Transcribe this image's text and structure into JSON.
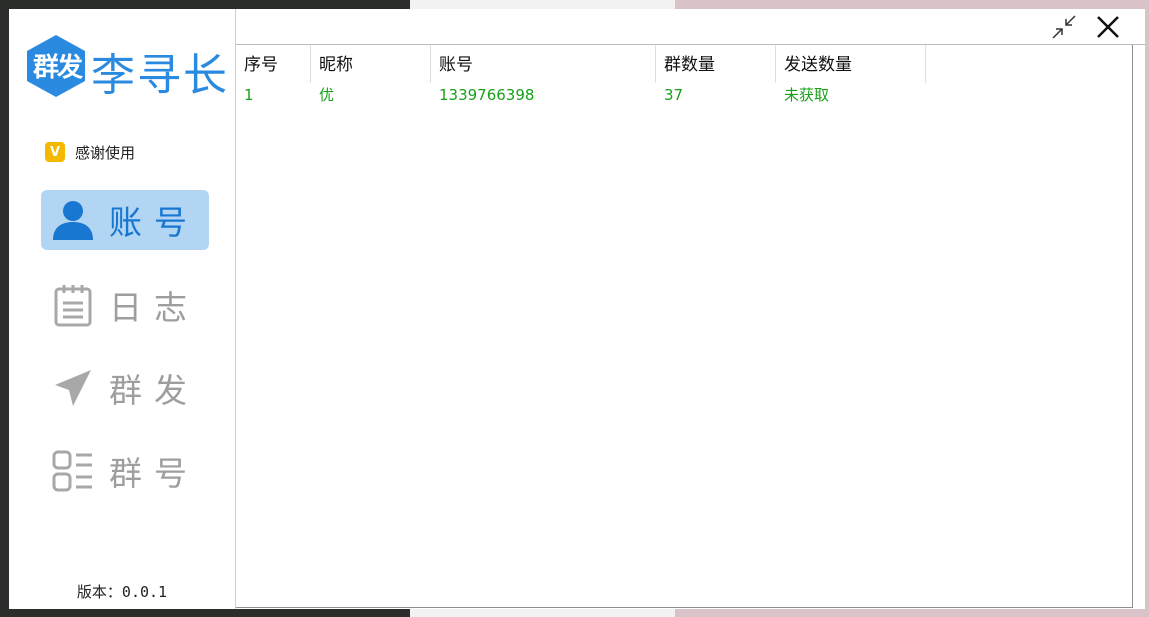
{
  "app": {
    "logo_badge": "群发",
    "name": "李寻长",
    "thanks": "感谢使用",
    "thanks_badge": "V",
    "version": "版本：0.0.1"
  },
  "nav": [
    {
      "label": "账号",
      "icon": "user-icon",
      "active": true
    },
    {
      "label": "日志",
      "icon": "notepad-icon",
      "active": false
    },
    {
      "label": "群发",
      "icon": "send-icon",
      "active": false
    },
    {
      "label": "群号",
      "icon": "list-icon",
      "active": false
    }
  ],
  "table": {
    "headers": [
      "序号",
      "昵称",
      "账号",
      "群数量",
      "发送数量"
    ],
    "rows": [
      [
        "1",
        "优",
        "1339766398",
        "37",
        "未获取"
      ]
    ]
  },
  "colors": {
    "accent": "#2a8ae0",
    "active_nav_bg": "#b3d5f4",
    "row_text": "#18a018",
    "badge": "#f5b800"
  }
}
